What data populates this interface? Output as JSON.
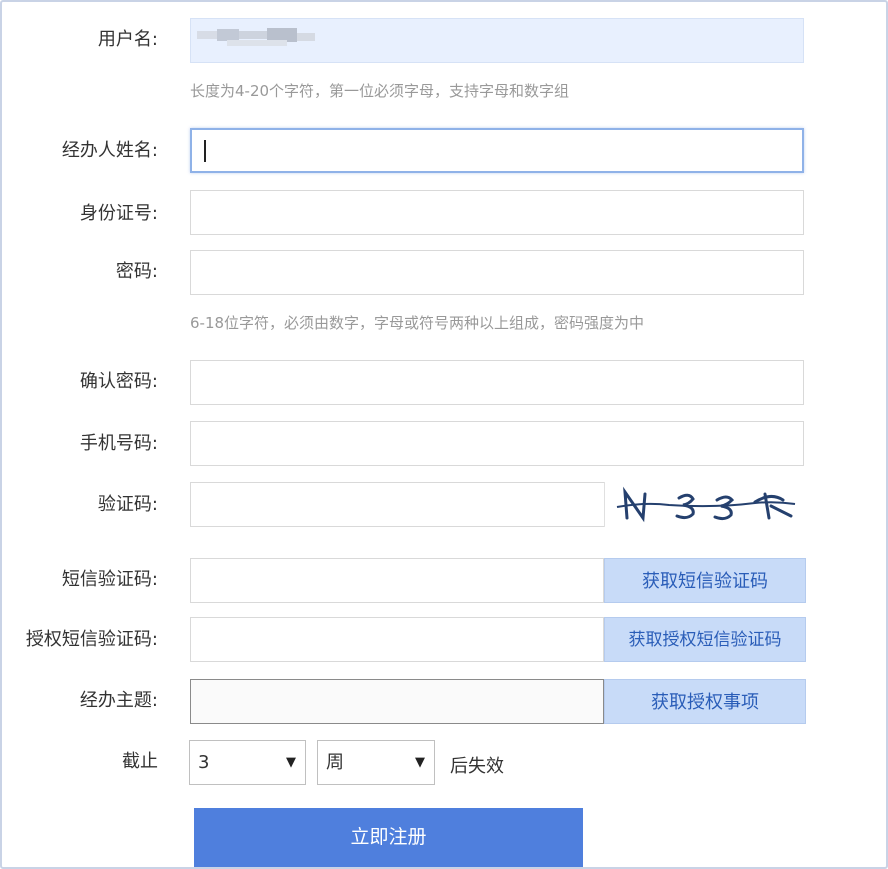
{
  "form": {
    "username": {
      "label": "用户名:",
      "value": "",
      "hint": "长度为4-20个字符，第一位必须字母，支持字母和数字组"
    },
    "operator_name": {
      "label": "经办人姓名:",
      "value": ""
    },
    "id_number": {
      "label": "身份证号:",
      "value": ""
    },
    "password": {
      "label": "密码:",
      "value": "",
      "hint": "6-18位字符，必须由数字，字母或符号两种以上组成，密码强度为中"
    },
    "confirm_password": {
      "label": "确认密码:",
      "value": ""
    },
    "phone": {
      "label": "手机号码:",
      "value": ""
    },
    "captcha": {
      "label": "验证码:",
      "value": "",
      "image_text": "N33X"
    },
    "sms_code": {
      "label": "短信验证码:",
      "value": "",
      "button": "获取短信验证码"
    },
    "auth_sms_code": {
      "label": "授权短信验证码:",
      "value": "",
      "button": "获取授权短信验证码"
    },
    "subject": {
      "label": "经办主题:",
      "value": "",
      "button": "获取授权事项"
    },
    "expiry": {
      "prefix": "截止",
      "amount": "3",
      "unit": "周",
      "suffix": "后失效"
    },
    "submit_label": "立即注册"
  },
  "colors": {
    "accent": "#4f7fdd",
    "side_button_bg": "#c8dbf8",
    "side_button_text": "#2a5db8",
    "hint": "#999999",
    "autofill_bg": "#e8f0fe"
  }
}
